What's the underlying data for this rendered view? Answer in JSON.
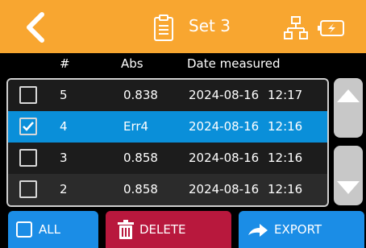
{
  "header": {
    "title": "Set 3",
    "back_icon": "chevron-left-icon",
    "clipboard_icon": "clipboard-icon",
    "network_icon": "network-icon",
    "battery_icon": "battery-charging-icon",
    "color": "#f8a630"
  },
  "table": {
    "columns": [
      "#",
      "Abs",
      "Date measured"
    ],
    "rows": [
      {
        "num": "5",
        "abs": "0.838",
        "date": "2024-08-16",
        "time": "12:17",
        "checked": false
      },
      {
        "num": "4",
        "abs": "Err4",
        "date": "2024-08-16",
        "time": "12:16",
        "checked": true
      },
      {
        "num": "3",
        "abs": "0.858",
        "date": "2024-08-16",
        "time": "12:16",
        "checked": false
      },
      {
        "num": "2",
        "abs": "0.858",
        "date": "2024-08-16",
        "time": "12:16",
        "checked": false
      }
    ],
    "selected_color": "#0a8fd9"
  },
  "scroll": {
    "up_icon": "triangle-up-icon",
    "down_icon": "triangle-down-icon"
  },
  "buttons": {
    "all_label": "ALL",
    "delete_label": "DELETE",
    "export_label": "EXPORT",
    "all_icon": "checkbox-icon",
    "delete_icon": "trash-icon",
    "export_icon": "arrow-right-icon",
    "primary_color": "#1b8de6",
    "danger_color": "#b8183d"
  }
}
